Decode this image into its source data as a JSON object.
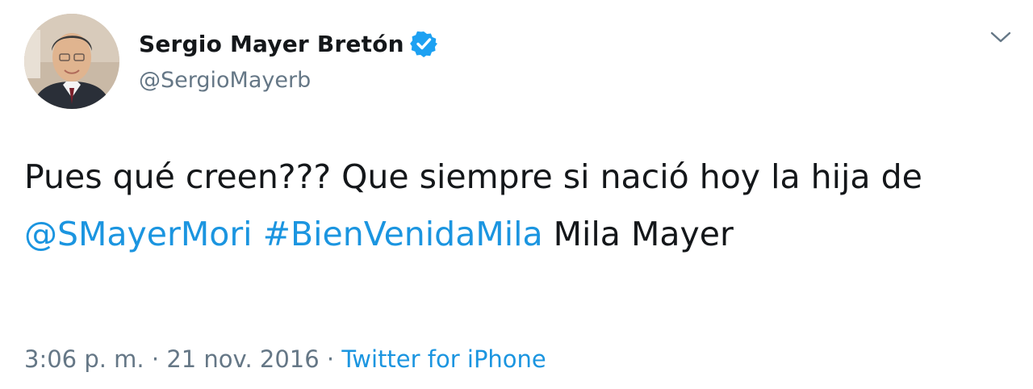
{
  "user": {
    "display_name": "Sergio Mayer Bretón",
    "handle": "@SergioMayerb",
    "verified": true,
    "avatar_icon": "avatar-photo"
  },
  "menu": {
    "icon": "chevron-down-icon"
  },
  "tweet": {
    "segments": [
      {
        "kind": "text",
        "text": "Pues qué creen??? Que siempre si nació hoy la hija de "
      },
      {
        "kind": "mention",
        "text": "@SMayerMori"
      },
      {
        "kind": "text",
        "text": " "
      },
      {
        "kind": "hashtag",
        "text": "#BienVenidaMila"
      },
      {
        "kind": "text",
        "text": " Mila Mayer"
      }
    ]
  },
  "meta": {
    "time": "3:06 p. m.",
    "separator_1": " · ",
    "date": "21 nov. 2016",
    "separator_2": " · ",
    "source": "Twitter for iPhone"
  },
  "colors": {
    "link": "#1b95e0",
    "verified_badge": "#1da1f2",
    "secondary_text": "#657786",
    "primary_text": "#14171a"
  }
}
